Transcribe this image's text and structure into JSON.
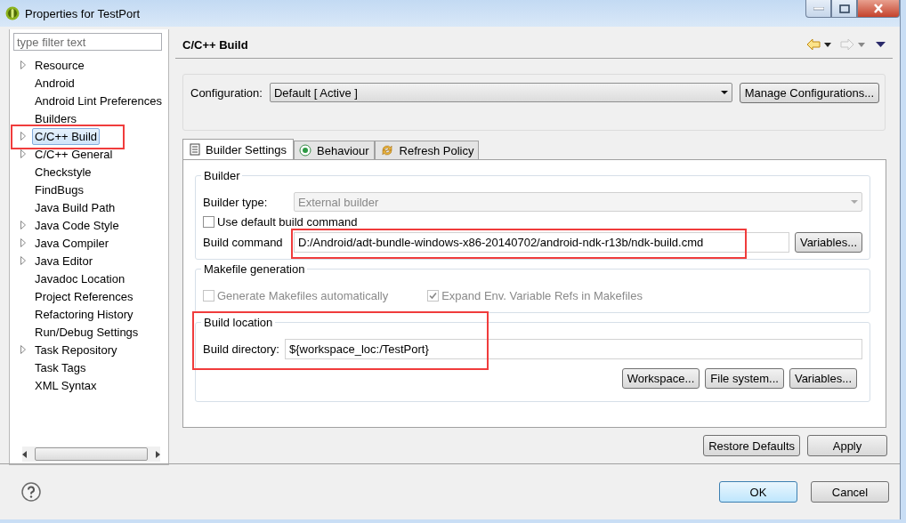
{
  "window": {
    "title": "Properties for TestPort"
  },
  "filter": {
    "placeholder": "type filter text"
  },
  "tree": [
    {
      "label": "Resource",
      "expandable": true,
      "selected": false
    },
    {
      "label": "Android",
      "expandable": false,
      "selected": false
    },
    {
      "label": "Android Lint Preferences",
      "expandable": false,
      "selected": false
    },
    {
      "label": "Builders",
      "expandable": false,
      "selected": false
    },
    {
      "label": "C/C++ Build",
      "expandable": true,
      "selected": true
    },
    {
      "label": "C/C++ General",
      "expandable": true,
      "selected": false
    },
    {
      "label": "Checkstyle",
      "expandable": false,
      "selected": false
    },
    {
      "label": "FindBugs",
      "expandable": false,
      "selected": false
    },
    {
      "label": "Java Build Path",
      "expandable": false,
      "selected": false
    },
    {
      "label": "Java Code Style",
      "expandable": true,
      "selected": false
    },
    {
      "label": "Java Compiler",
      "expandable": true,
      "selected": false
    },
    {
      "label": "Java Editor",
      "expandable": true,
      "selected": false
    },
    {
      "label": "Javadoc Location",
      "expandable": false,
      "selected": false
    },
    {
      "label": "Project References",
      "expandable": false,
      "selected": false
    },
    {
      "label": "Refactoring History",
      "expandable": false,
      "selected": false
    },
    {
      "label": "Run/Debug Settings",
      "expandable": false,
      "selected": false
    },
    {
      "label": "Task Repository",
      "expandable": true,
      "selected": false
    },
    {
      "label": "Task Tags",
      "expandable": false,
      "selected": false
    },
    {
      "label": "XML Syntax",
      "expandable": false,
      "selected": false
    }
  ],
  "page": {
    "title": "C/C++ Build"
  },
  "configuration": {
    "label": "Configuration:",
    "value": "Default  [ Active ]",
    "button": "Manage Configurations..."
  },
  "tabs": [
    {
      "label": "Builder Settings",
      "selected": true
    },
    {
      "label": "Behaviour",
      "selected": false
    },
    {
      "label": "Refresh Policy",
      "selected": false
    }
  ],
  "builder": {
    "title": "Builder",
    "type_label": "Builder type:",
    "type_value": "External builder",
    "type_disabled": true,
    "use_default": {
      "label": "Use default build command",
      "checked": false
    },
    "command_label": "Build command",
    "command_value": "D:/Android/adt-bundle-windows-x86-20140702/android-ndk-r13b/ndk-build.cmd",
    "variables_button": "Variables..."
  },
  "makefile": {
    "title": "Makefile generation",
    "options": [
      {
        "label": "Generate Makefiles automatically",
        "checked": false,
        "disabled": true
      },
      {
        "label": "Expand Env. Variable Refs in Makefiles",
        "checked": true,
        "disabled": true
      }
    ]
  },
  "location": {
    "title": "Build location",
    "dir_label": "Build directory:",
    "dir_value": "${workspace_loc:/TestPort}",
    "buttons": [
      "Workspace...",
      "File system...",
      "Variables..."
    ]
  },
  "page_buttons": [
    "Restore Defaults",
    "Apply"
  ],
  "dialog_buttons": [
    {
      "label": "OK",
      "default": true
    },
    {
      "label": "Cancel",
      "default": false
    }
  ]
}
